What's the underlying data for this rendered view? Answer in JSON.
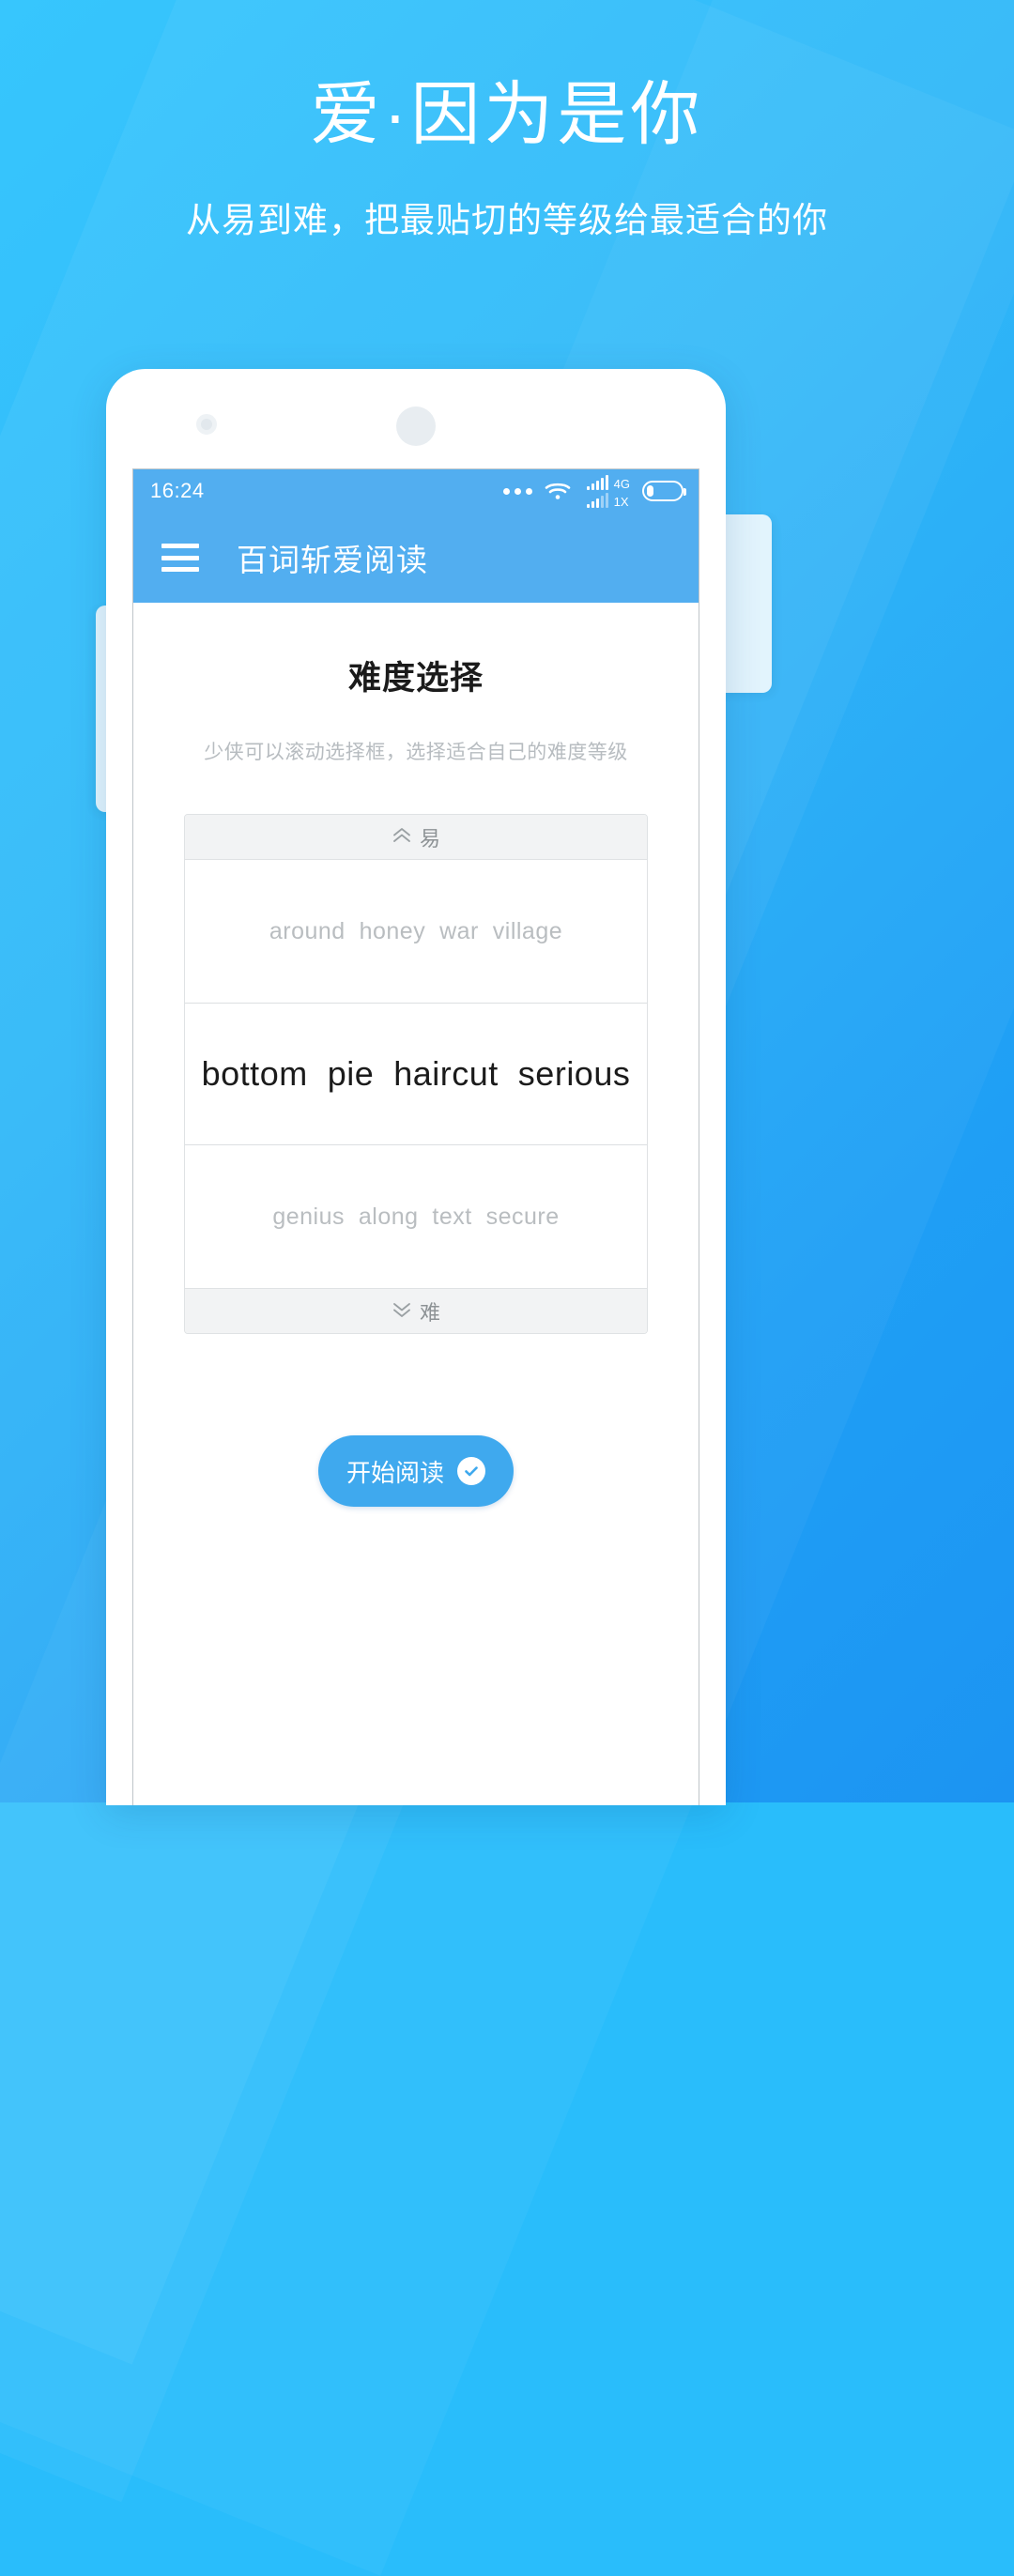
{
  "promo": {
    "title": "爱·因为是你",
    "subtitle": "从易到难，把最贴切的等级给最适合的你"
  },
  "colors": {
    "background_start": "#2ec4fd",
    "background_end": "#1c94f2",
    "app_bar": "#52aef0",
    "accent_button": "#3fa9ee",
    "muted_text": "#b9bdc0"
  },
  "phone": {
    "status_bar": {
      "time": "16:24",
      "dots_icon": "more-dots-icon",
      "wifi_icon": "wifi-icon",
      "signal_primary_label": "4G",
      "signal_secondary_label": "1X",
      "battery_icon": "battery-icon"
    },
    "app_bar": {
      "menu_icon": "hamburger-menu-icon",
      "title": "百词斩爱阅读"
    },
    "content": {
      "heading": "难度选择",
      "hint": "少侠可以滚动选择框，选择适合自己的难度等级",
      "picker": {
        "top_label": "易",
        "top_icon": "chevron-double-up-icon",
        "bottom_label": "难",
        "bottom_icon": "chevron-double-down-icon",
        "rows": [
          {
            "text": "around  honey  war  village",
            "selected": false
          },
          {
            "text": "bottom  pie  haircut  serious",
            "selected": true
          },
          {
            "text": "genius  along  text  secure",
            "selected": false
          }
        ]
      },
      "start_button": {
        "label": "开始阅读",
        "icon": "check-circle-icon"
      }
    }
  }
}
